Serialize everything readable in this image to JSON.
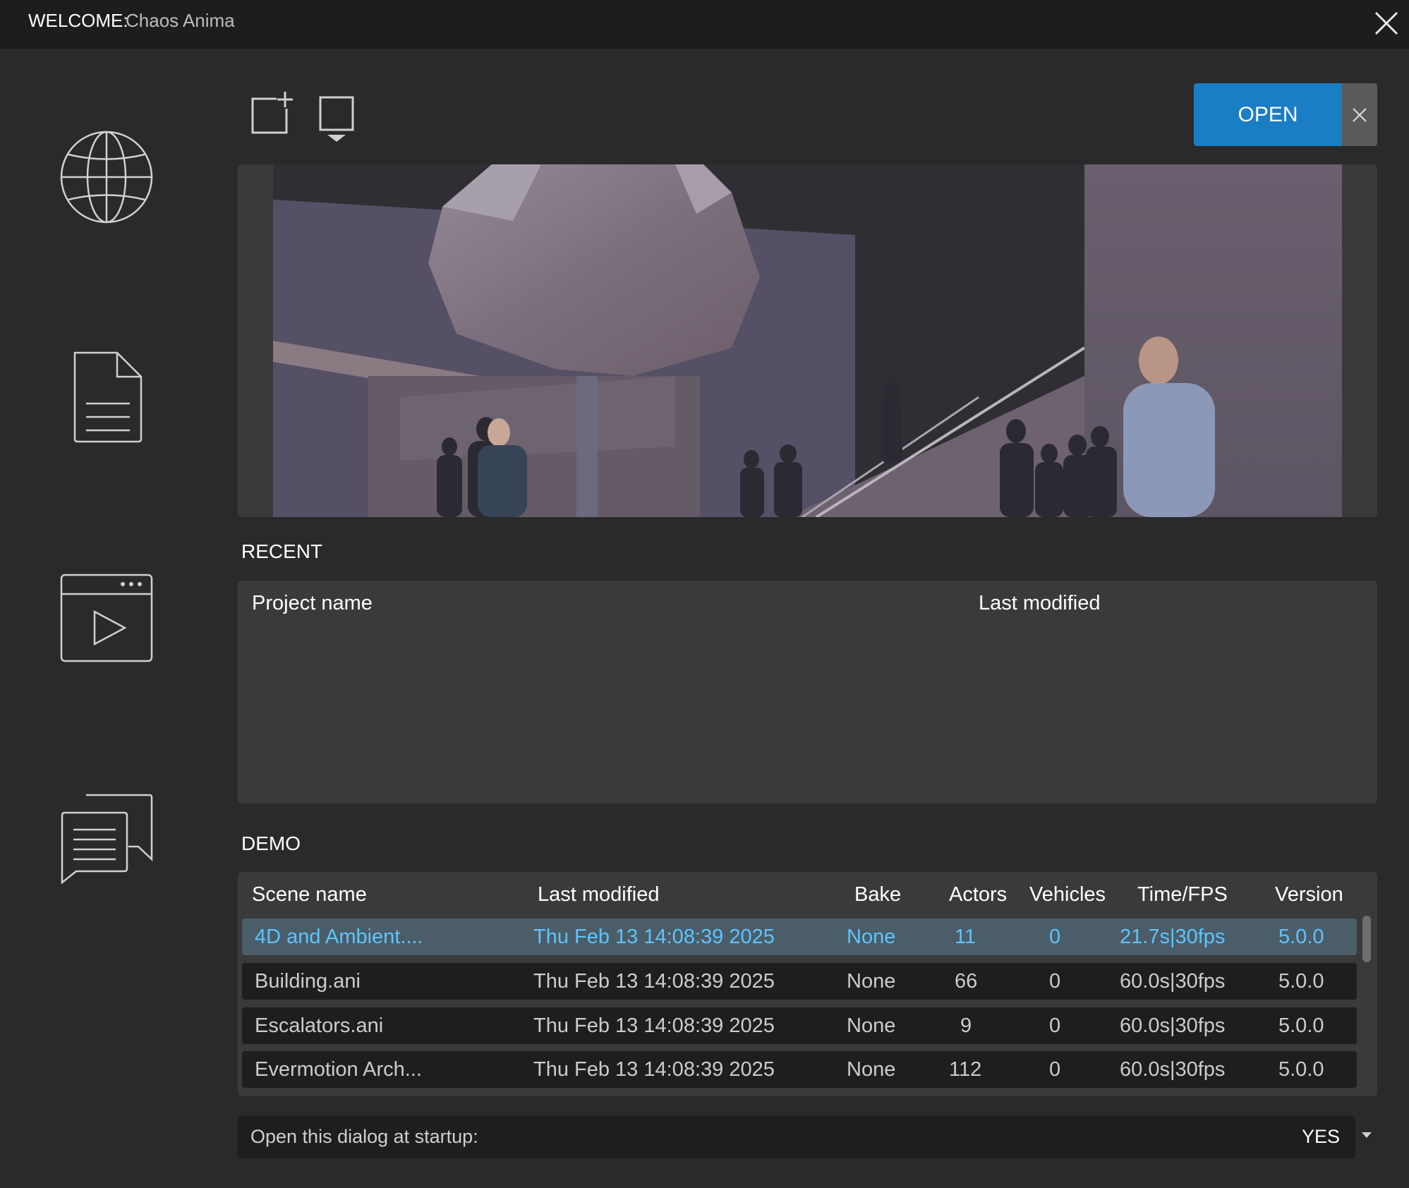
{
  "window": {
    "title_label": "WELCOME:",
    "app_name": "Chaos Anima"
  },
  "sidebar": {
    "items": [
      {
        "icon": "globe-icon"
      },
      {
        "icon": "document-icon"
      },
      {
        "icon": "video-player-icon"
      },
      {
        "icon": "chat-icon"
      }
    ]
  },
  "toolbar": {
    "new_icon": "new-project-icon",
    "import_icon": "open-monitor-icon",
    "open_label": "OPEN"
  },
  "recent": {
    "section_label": "RECENT",
    "columns": [
      "Project name",
      "Last modified"
    ],
    "rows": []
  },
  "demo": {
    "section_label": "DEMO",
    "columns": [
      "Scene name",
      "Last modified",
      "Bake",
      "Actors",
      "Vehicles",
      "Time/FPS",
      "Version"
    ],
    "rows": [
      {
        "name": "4D and Ambient....",
        "modified": "Thu Feb 13 14:08:39 2025",
        "bake": "None",
        "actors": "11",
        "vehicles": "0",
        "time": "21.7s|30fps",
        "version": "5.0.0"
      },
      {
        "name": "Building.ani",
        "modified": "Thu Feb 13 14:08:39 2025",
        "bake": "None",
        "actors": "66",
        "vehicles": "0",
        "time": "60.0s|30fps",
        "version": "5.0.0"
      },
      {
        "name": "Escalators.ani",
        "modified": "Thu Feb 13 14:08:39 2025",
        "bake": "None",
        "actors": "9",
        "vehicles": "0",
        "time": "60.0s|30fps",
        "version": "5.0.0"
      },
      {
        "name": "Evermotion Arch...",
        "modified": "Thu Feb 13 14:08:39 2025",
        "bake": "None",
        "actors": "112",
        "vehicles": "0",
        "time": "60.0s|30fps",
        "version": "5.0.0"
      }
    ]
  },
  "startup": {
    "label": "Open this dialog at startup:",
    "value": "YES"
  },
  "colors": {
    "accent": "#1a7ec4",
    "selected_text": "#5ec4ff",
    "selected_row": "#4b5d69"
  }
}
